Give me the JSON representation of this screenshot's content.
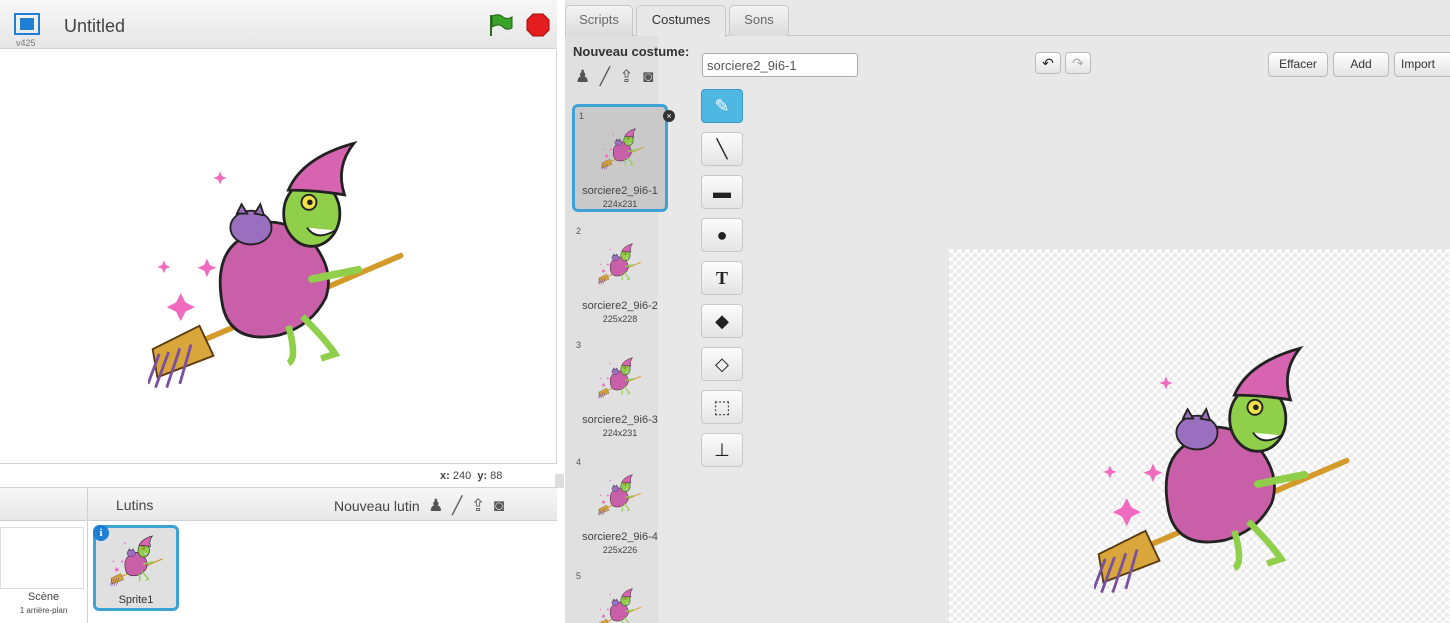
{
  "stage": {
    "version": "v425",
    "title": "Untitled",
    "coords": {
      "x_label": "x:",
      "x": "240",
      "y_label": "y:",
      "y": "88"
    }
  },
  "sprites_pane": {
    "header": "Lutins",
    "new_sprite_label": "Nouveau lutin",
    "scene": {
      "label": "Scène",
      "sub": "1 arrière-plan"
    },
    "sprites": [
      {
        "name": "Sprite1"
      }
    ]
  },
  "tabs": [
    "Scripts",
    "Costumes",
    "Sons"
  ],
  "costumes": {
    "new_costume_label": "Nouveau costume:",
    "items": [
      {
        "num": "1",
        "name": "sorciere2_9i6-1",
        "size": "224x231"
      },
      {
        "num": "2",
        "name": "sorciere2_9i6-2",
        "size": "225x228"
      },
      {
        "num": "3",
        "name": "sorciere2_9i6-3",
        "size": "224x231"
      },
      {
        "num": "4",
        "name": "sorciere2_9i6-4",
        "size": "225x226"
      },
      {
        "num": "5",
        "name": "",
        "size": ""
      }
    ]
  },
  "editor": {
    "costume_name": "sorciere2_9i6-1",
    "clear_label": "Effacer",
    "add_label": "Add",
    "import_label": "Import"
  },
  "colors": {
    "accent": "#3da3d6",
    "active_tool": "#4eb7e2",
    "robe": "#c95fa8",
    "skin": "#8fcf4a"
  }
}
